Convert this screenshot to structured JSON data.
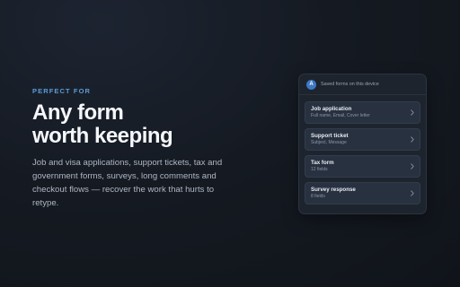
{
  "hero": {
    "eyebrow": "PERFECT FOR",
    "headline_line1": "Any form",
    "headline_line2": "worth keeping",
    "description": "Job and visa applications, support tickets, tax and government forms, surveys, long comments and checkout flows — recover the work that hurts to retype."
  },
  "panel": {
    "avatar_letter": "A",
    "header": "Saved forms on this device",
    "items": [
      {
        "title": "Job application",
        "subtitle": "Full name, Email, Cover letter"
      },
      {
        "title": "Support ticket",
        "subtitle": "Subject, Message"
      },
      {
        "title": "Tax form",
        "subtitle": "12 fields"
      },
      {
        "title": "Survey response",
        "subtitle": "8 fields"
      }
    ]
  },
  "colors": {
    "accent": "#5b9bd8",
    "avatar": "#3d78c4",
    "background": "#151a22"
  },
  "icons": {
    "item_chevron": "chevron-right-icon"
  }
}
